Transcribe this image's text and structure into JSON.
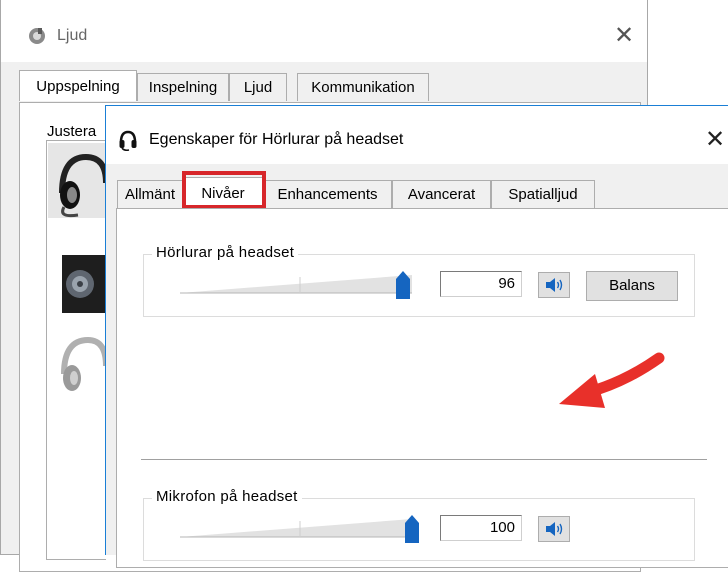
{
  "back_window": {
    "title": "Ljud",
    "tabs": [
      {
        "label": "Uppspelning",
        "active": true
      },
      {
        "label": "Inspelning",
        "active": false
      },
      {
        "label": "Ljud",
        "active": false
      },
      {
        "label": "Kommunikation",
        "active": false
      }
    ],
    "hint": "Justera"
  },
  "dialog": {
    "title": "Egenskaper för Hörlurar på headset",
    "tabs": [
      {
        "label": "Allmänt",
        "active": false
      },
      {
        "label": "Nivåer",
        "active": true
      },
      {
        "label": "Enhancements",
        "active": false
      },
      {
        "label": "Avancerat",
        "active": false
      },
      {
        "label": "Spatialljud",
        "active": false
      }
    ],
    "levels": [
      {
        "label": "Hörlurar på headset",
        "value": "96",
        "level": 96,
        "has_balance": true
      },
      {
        "label": "Mikrofon på headset",
        "value": "100",
        "level": 100,
        "has_balance": false
      }
    ],
    "balance_label": "Balans"
  },
  "colors": {
    "highlight": "#d7262a",
    "arrow": "#e8302a",
    "slider_thumb": "#1565c0",
    "dialog_border": "#1a7fd6"
  },
  "icons": [
    "speaker-icon",
    "headset-icon",
    "close-icon"
  ]
}
